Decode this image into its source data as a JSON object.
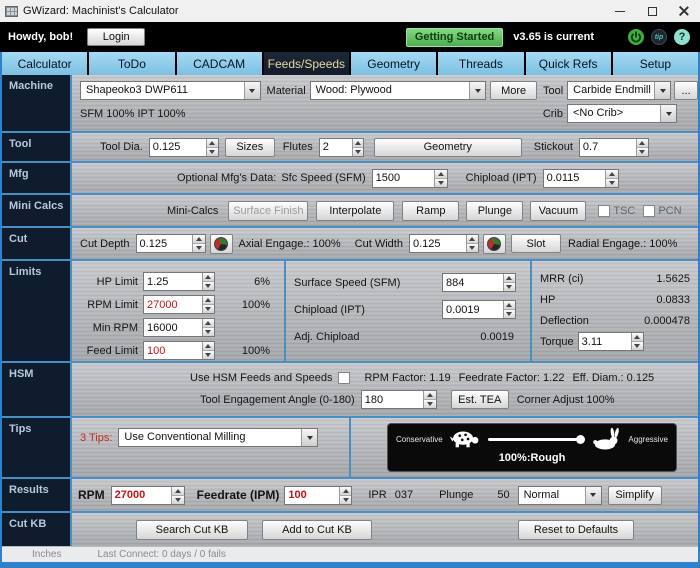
{
  "window": {
    "title": "GWizard: Machinist's Calculator"
  },
  "header": {
    "greeting": "Howdy, bob!",
    "login_label": "Login",
    "getting_started_label": "Getting Started",
    "version_text": "v3.65 is current",
    "tip_icon_text": "tip",
    "help_icon_text": "?"
  },
  "tabs": [
    {
      "label": "Calculator",
      "active": false
    },
    {
      "label": "ToDo",
      "active": false
    },
    {
      "label": "CADCAM",
      "active": false
    },
    {
      "label": "Feeds/Speeds",
      "active": true
    },
    {
      "label": "Geometry",
      "active": false
    },
    {
      "label": "Threads",
      "active": false
    },
    {
      "label": "Quick Refs",
      "active": false
    },
    {
      "label": "Setup",
      "active": false
    }
  ],
  "machine": {
    "section_label": "Machine",
    "machine_select": "Shapeoko3 DWP611",
    "material_label": "Material",
    "material_select": "Wood: Plywood",
    "more_button": "More",
    "tool_label": "Tool",
    "tool_select": "Carbide Endmill",
    "ellipsis_button": "...",
    "sfm_ipt_text": "SFM 100%  IPT 100%",
    "crib_label": "Crib",
    "crib_select": "<No Crib>"
  },
  "tool": {
    "section_label": "Tool",
    "tool_dia_label": "Tool Dia.",
    "tool_dia_value": "0.125",
    "sizes_button": "Sizes",
    "flutes_label": "Flutes",
    "flutes_value": "2",
    "geometry_button": "Geometry",
    "stickout_label": "Stickout",
    "stickout_value": "0.7"
  },
  "mfg": {
    "section_label": "Mfg",
    "optional_label": "Optional Mfg's Data:",
    "sfc_speed_label": "Sfc Speed (SFM)",
    "sfc_speed_value": "1500",
    "chipload_label": "Chipload (IPT)",
    "chipload_value": "0.0115"
  },
  "mini_calcs": {
    "section_label": "Mini Calcs",
    "group_label": "Mini-Calcs",
    "buttons": [
      {
        "label": "Surface Finish",
        "disabled": true
      },
      {
        "label": "Interpolate",
        "disabled": false
      },
      {
        "label": "Ramp",
        "disabled": false
      },
      {
        "label": "Plunge",
        "disabled": false
      },
      {
        "label": "Vacuum",
        "disabled": false
      }
    ],
    "tsc_label": "TSC",
    "pcn_label": "PCN"
  },
  "cut": {
    "section_label": "Cut",
    "cut_depth_label": "Cut Depth",
    "cut_depth_value": "0.125",
    "axial_label": "Axial Engage.: 100%",
    "cut_width_label": "Cut Width",
    "cut_width_value": "0.125",
    "slot_button": "Slot",
    "radial_label": "Radial Engage.: 100%"
  },
  "limits": {
    "section_label": "Limits",
    "col1": [
      {
        "label": "HP Limit",
        "value": "1.25",
        "pct": "6%"
      },
      {
        "label": "RPM Limit",
        "value": "27000",
        "pct": "100%"
      },
      {
        "label": "Min RPM",
        "value": "16000",
        "pct": ""
      },
      {
        "label": "Feed Limit",
        "value": "100",
        "pct": "100%"
      }
    ],
    "surface_speed_label": "Surface Speed (SFM)",
    "surface_speed_value": "884",
    "chipload_label": "Chipload (IPT)",
    "chipload_value": "0.0019",
    "adj_chipload_label": "Adj. Chipload",
    "adj_chipload_value": "0.0019",
    "mrr_label": "MRR (ci)",
    "mrr_value": "1.5625",
    "hp_label": "HP",
    "hp_value": "0.0833",
    "deflection_label": "Deflection",
    "deflection_value": "0.000478",
    "torque_label": "Torque",
    "torque_value": "3.11"
  },
  "hsm": {
    "section_label": "HSM",
    "use_hsm_label": "Use HSM Feeds and Speeds",
    "rpm_factor": "RPM Factor: 1.19",
    "feedrate_factor": "Feedrate Factor: 1.22",
    "eff_diam": "Eff. Diam.: 0.125",
    "tea_label": "Tool Engagement Angle (0-180)",
    "tea_value": "180",
    "est_tea_button": "Est. TEA",
    "corner_adjust": "Corner Adjust 100%"
  },
  "tips": {
    "section_label": "Tips",
    "tips_count": "3 Tips:",
    "tip_select": "Use Conventional Milling",
    "slider_left_label": "Conservative",
    "slider_right_label": "Aggressive",
    "slider_caption": "100%:Rough"
  },
  "results": {
    "section_label": "Results",
    "rpm_label": "RPM",
    "rpm_value": "27000",
    "feedrate_label": "Feedrate (IPM)",
    "feedrate_value": "100",
    "ipr_label": "IPR",
    "ipr_value": "037",
    "plunge_label": "Plunge",
    "plunge_value": "50",
    "plunge_select": "Normal",
    "simplify_button": "Simplify"
  },
  "cutkb": {
    "section_label": "Cut KB",
    "search_button": "Search Cut KB",
    "add_button": "Add to Cut KB",
    "reset_button": "Reset to Defaults"
  },
  "statusbar": {
    "units": "Inches",
    "last_connect": "Last Connect: 0 days / 0 fails"
  },
  "icons": {
    "power_icon": "green power/refresh circle",
    "tip_icon": "tip jar circle",
    "help_icon": "question mark circle",
    "gauge_icon": "engagement speed gauge",
    "turtle_icon": "conservative turtle",
    "rabbit_icon": "aggressive rabbit"
  },
  "colors": {
    "accent_blue": "#4a8fc4",
    "sidebar_navy": "#0e1c2e",
    "tab_blue": "#8cceee",
    "active_tab_text": "#e8d8a4",
    "alert_red": "#c41414",
    "green_button": "#4cae4c",
    "window_border": "#2e82cc"
  }
}
